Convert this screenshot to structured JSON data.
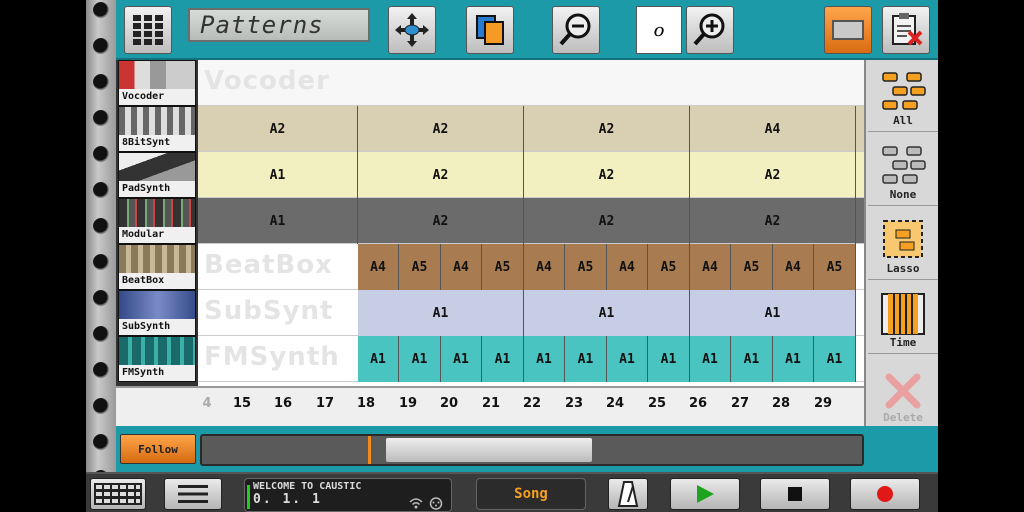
{
  "header": {
    "pattern_title": "Patterns",
    "zoom_value": "o"
  },
  "tracks": [
    {
      "label": "Vocoder",
      "ghost": "Vocoder"
    },
    {
      "label": "8BitSynt",
      "ghost": ""
    },
    {
      "label": "PadSynth",
      "ghost": ""
    },
    {
      "label": "Modular",
      "ghost": ""
    },
    {
      "label": "BeatBox",
      "ghost": "BeatBox"
    },
    {
      "label": "SubSynth",
      "ghost": "SubSynt"
    },
    {
      "label": "FMSynth",
      "ghost": "FMSynth"
    }
  ],
  "patterns": {
    "8bit": [
      "A2",
      "A2",
      "A2",
      "A4"
    ],
    "pad": [
      "A1",
      "A2",
      "A2",
      "A2"
    ],
    "modular": [
      "A1",
      "A2",
      "A2",
      "A2"
    ],
    "beatbox": [
      "A4",
      "A5",
      "A4",
      "A5",
      "A4",
      "A5",
      "A4",
      "A5",
      "A4",
      "A5",
      "A4",
      "A5"
    ],
    "subsynth": [
      "A1",
      "A1",
      "A1"
    ],
    "fmsynth": [
      "A1",
      "A1",
      "A1",
      "A1",
      "A1",
      "A1",
      "A1",
      "A1",
      "A1",
      "A1",
      "A1",
      "A1"
    ]
  },
  "timeline": {
    "partial": "4",
    "ticks": [
      "15",
      "16",
      "17",
      "18",
      "19",
      "20",
      "21",
      "22",
      "23",
      "24",
      "25",
      "26",
      "27",
      "28",
      "29"
    ]
  },
  "rightbar": {
    "all": "All",
    "none": "None",
    "lasso": "Lasso",
    "time": "Time",
    "delete": "Delete"
  },
  "scroll": {
    "follow": "Follow"
  },
  "bottom": {
    "lcd_line1": "WELCOME TO CAUSTIC",
    "lcd_line2": "0. 1. 1",
    "song": "Song"
  },
  "colors": {
    "accent": "#1d9aa8",
    "orange": "#f28a1c",
    "8bit": "#d9d0b4",
    "pad": "#f2f0c0",
    "modular": "#6b6b6b",
    "beatbox": "#a87c50",
    "subsynth": "#c8cde6",
    "fmsynth": "#4ac4c0"
  }
}
